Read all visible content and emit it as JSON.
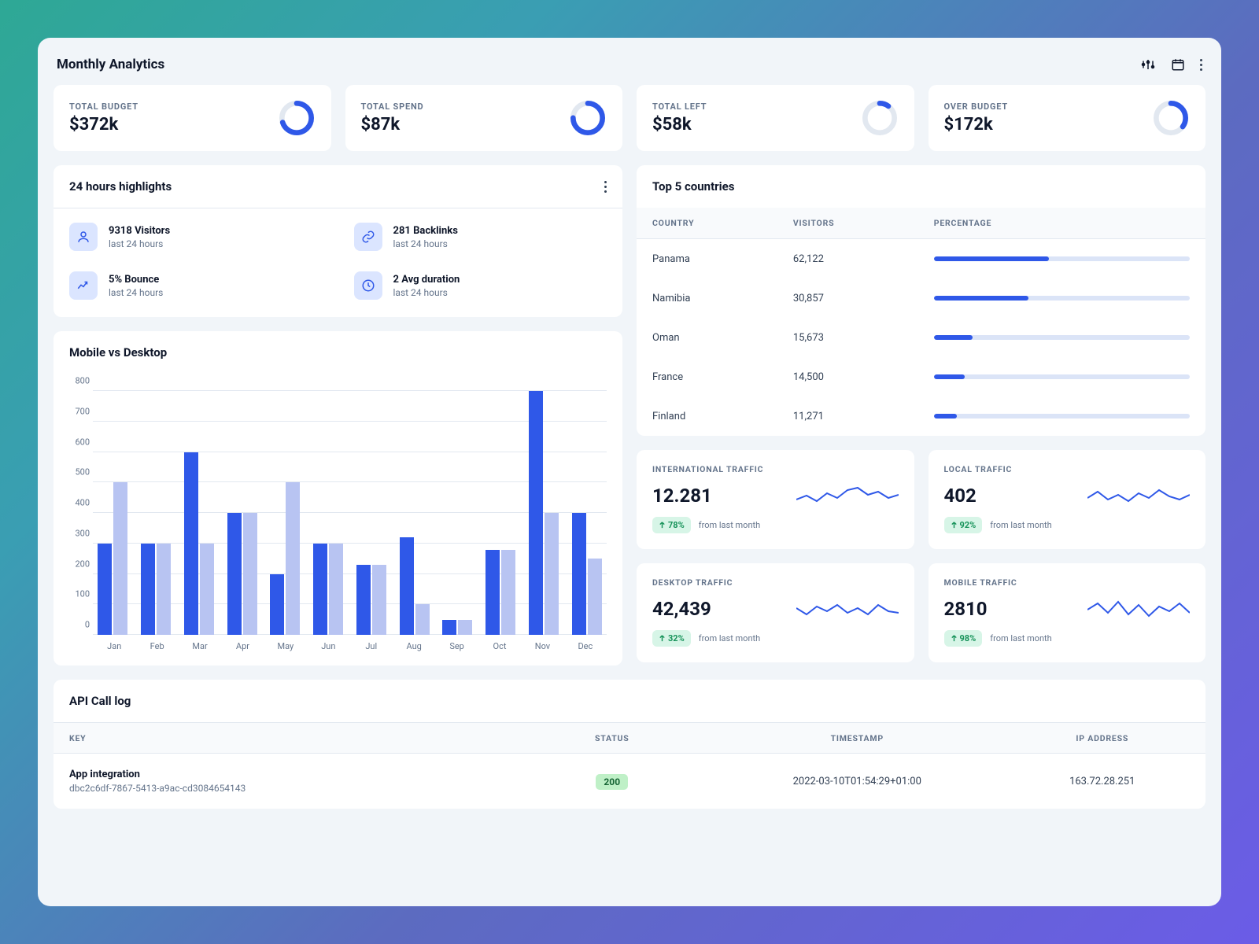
{
  "header": {
    "title": "Monthly Analytics"
  },
  "kpis": [
    {
      "label": "TOTAL BUDGET",
      "value": "$372k",
      "pct": 70
    },
    {
      "label": "TOTAL SPEND",
      "value": "$87k",
      "pct": 75
    },
    {
      "label": "TOTAL LEFT",
      "value": "$58k",
      "pct": 10
    },
    {
      "label": "OVER BUDGET",
      "value": "$172k",
      "pct": 35
    }
  ],
  "highlights": {
    "title": "24 hours highlights",
    "items": [
      {
        "icon": "user",
        "title": "9318 Visitors",
        "sub": "last 24 hours"
      },
      {
        "icon": "link",
        "title": "281 Backlinks",
        "sub": "last 24 hours"
      },
      {
        "icon": "trend",
        "title": "5% Bounce",
        "sub": "last 24 hours"
      },
      {
        "icon": "clock",
        "title": "2 Avg duration",
        "sub": "last 24 hours"
      }
    ]
  },
  "mvd": {
    "title": "Mobile vs Desktop"
  },
  "chart_data": {
    "type": "bar",
    "title": "Mobile vs Desktop",
    "ylabel": "",
    "xlabel": "",
    "ylim": [
      0,
      800
    ],
    "y_ticks": [
      0,
      100,
      200,
      300,
      400,
      500,
      600,
      700,
      800
    ],
    "categories": [
      "Jan",
      "Feb",
      "Mar",
      "Apr",
      "May",
      "Jun",
      "Jul",
      "Aug",
      "Sep",
      "Oct",
      "Nov",
      "Dec"
    ],
    "series": [
      {
        "name": "Mobile",
        "color": "#2f58e8",
        "values": [
          300,
          300,
          600,
          400,
          200,
          300,
          230,
          320,
          50,
          280,
          800,
          400
        ]
      },
      {
        "name": "Desktop",
        "color": "#b8c4f2",
        "values": [
          500,
          300,
          300,
          400,
          500,
          300,
          230,
          100,
          50,
          280,
          400,
          250
        ]
      }
    ]
  },
  "countries": {
    "title": "Top 5 countries",
    "columns": [
      "COUNTRY",
      "VISITORS",
      "PERCENTAGE"
    ],
    "rows": [
      {
        "country": "Panama",
        "visitors": "62,122",
        "pct": 45
      },
      {
        "country": "Namibia",
        "visitors": "30,857",
        "pct": 37
      },
      {
        "country": "Oman",
        "visitors": "15,673",
        "pct": 15
      },
      {
        "country": "France",
        "visitors": "14,500",
        "pct": 12
      },
      {
        "country": "Finland",
        "visitors": "11,271",
        "pct": 9
      }
    ]
  },
  "traffic": [
    {
      "label": "INTERNATIONAL TRAFFIC",
      "value": "12.281",
      "delta": "78%",
      "from": "from last month"
    },
    {
      "label": "LOCAL TRAFFIC",
      "value": "402",
      "delta": "92%",
      "from": "from last month"
    },
    {
      "label": "DESKTOP TRAFFIC",
      "value": "42,439",
      "delta": "32%",
      "from": "from last month"
    },
    {
      "label": "MOBILE TRAFFIC",
      "value": "2810",
      "delta": "98%",
      "from": "from last month"
    }
  ],
  "api": {
    "title": "API Call log",
    "columns": [
      "KEY",
      "STATUS",
      "TIMESTAMP",
      "IP ADDRESS"
    ],
    "rows": [
      {
        "name": "App integration",
        "hash": "dbc2c6df-7867-5413-a9ac-cd3084654143",
        "status": "200",
        "ts": "2022-03-10T01:54:29+01:00",
        "ip": "163.72.28.251"
      }
    ]
  }
}
